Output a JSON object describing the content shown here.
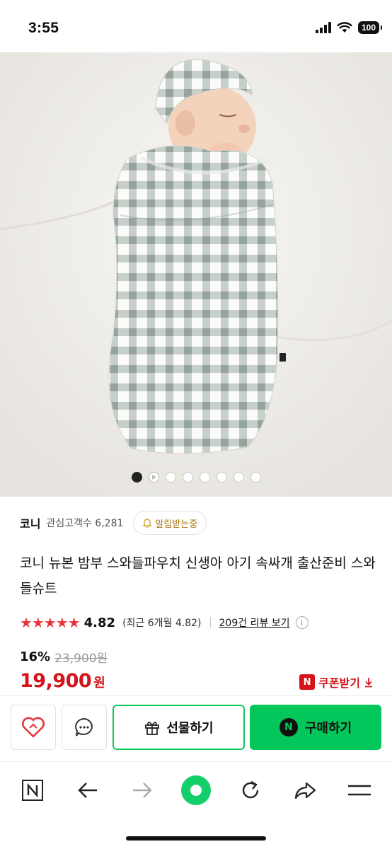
{
  "status": {
    "time": "3:55",
    "battery": "100"
  },
  "gallery": {
    "image": "baby-swaddle-gingham-photo",
    "current_slide": 1,
    "slide_count": 8,
    "video_slide": 2
  },
  "seller": {
    "name": "코니",
    "fans": "관심고객수 6,281",
    "notify_label": "알림받는중"
  },
  "product": {
    "title": "코니 뉴본 밤부 스와들파우치 신생아 아기 속싸개 출산준비 스와들슈트",
    "stars": "★★★★★",
    "rating_value": 5,
    "rating": "4.82",
    "recent_rating": "(최근 6개월 4.82)",
    "review_link": "209건 리뷰 보기",
    "discount": "16%",
    "original_price": "23,900원",
    "price": "19,900",
    "price_unit": "원",
    "coupon_label": "쿠폰받기",
    "coupon_badge": "N"
  },
  "actions": {
    "wishlist_icon": "heart-icon",
    "talk_icon": "chat-bubble-icon",
    "gift_label": "선물하기",
    "buy_label": "구매하기",
    "buy_badge": "N"
  },
  "browser": {
    "home_badge": "N",
    "items": [
      "naver-home-icon",
      "back-arrow-icon",
      "forward-arrow-icon",
      "green-dot-icon",
      "refresh-icon",
      "share-icon",
      "menu-icon"
    ]
  },
  "colors": {
    "accent_green": "#03c75a",
    "price_red": "#d4131a",
    "star_red": "#e5363d",
    "gingham_gray": "#a9b4ae"
  }
}
